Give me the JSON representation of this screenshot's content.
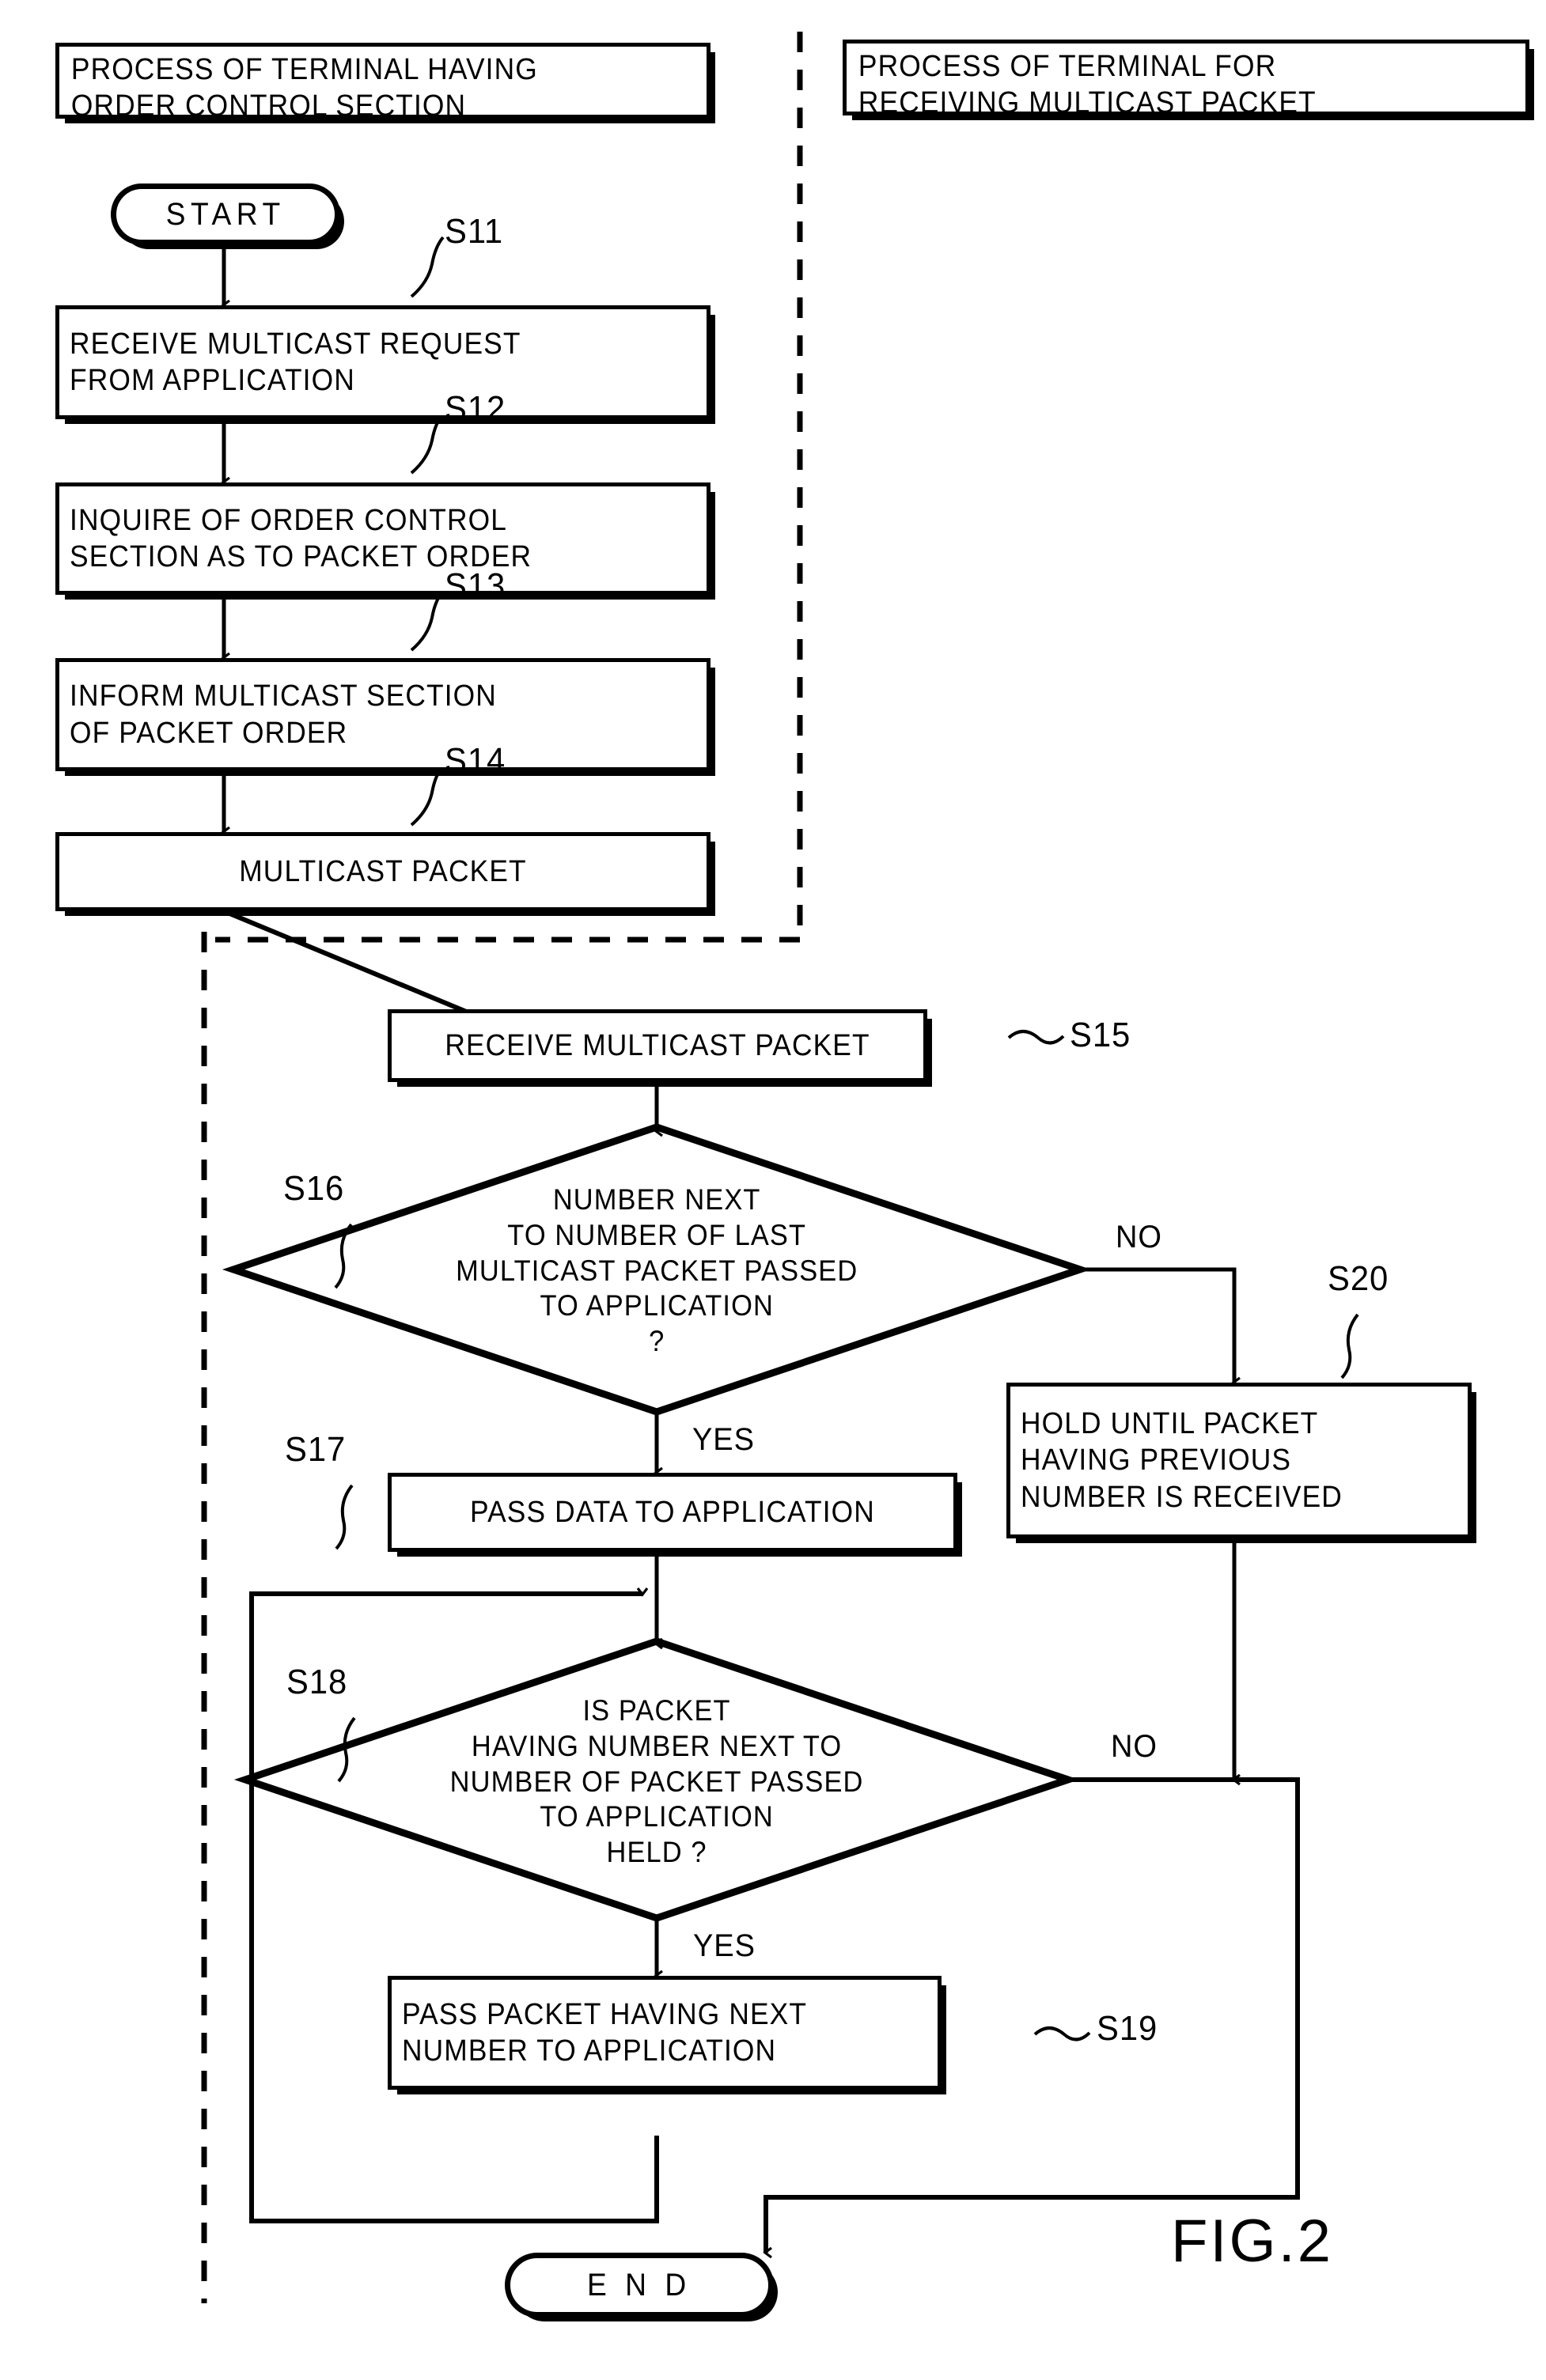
{
  "figure": {
    "label": "FIG.2",
    "lanes": [
      {
        "id": "lane-left",
        "title": "PROCESS OF TERMINAL HAVING\nORDER CONTROL SECTION"
      },
      {
        "id": "lane-right",
        "title": "PROCESS OF TERMINAL FOR\nRECEIVING MULTICAST PACKET"
      }
    ],
    "nodes": [
      {
        "id": "start",
        "type": "terminator",
        "text": "START",
        "step": ""
      },
      {
        "id": "s11",
        "type": "process",
        "text": "RECEIVE MULTICAST REQUEST\nFROM APPLICATION",
        "step": "S11"
      },
      {
        "id": "s12",
        "type": "process",
        "text": "INQUIRE OF ORDER CONTROL\nSECTION AS TO PACKET ORDER",
        "step": "S12"
      },
      {
        "id": "s13",
        "type": "process",
        "text": "INFORM MULTICAST SECTION\nOF PACKET ORDER",
        "step": "S13"
      },
      {
        "id": "s14",
        "type": "process",
        "text": "MULTICAST PACKET",
        "step": "S14"
      },
      {
        "id": "s15",
        "type": "process",
        "text": "RECEIVE MULTICAST PACKET",
        "step": "S15"
      },
      {
        "id": "s16",
        "type": "decision",
        "text": "NUMBER NEXT\nTO NUMBER OF LAST\nMULTICAST PACKET PASSED\nTO APPLICATION\n?",
        "step": "S16"
      },
      {
        "id": "s17",
        "type": "process",
        "text": "PASS DATA TO APPLICATION",
        "step": "S17"
      },
      {
        "id": "s20",
        "type": "process",
        "text": "HOLD UNTIL PACKET\nHAVING PREVIOUS\nNUMBER IS RECEIVED",
        "step": "S20"
      },
      {
        "id": "s18",
        "type": "decision",
        "text": "IS PACKET\nHAVING NUMBER NEXT TO\nNUMBER OF PACKET PASSED\nTO APPLICATION\nHELD ?",
        "step": "S18"
      },
      {
        "id": "s19",
        "type": "process",
        "text": "PASS PACKET HAVING NEXT\nNUMBER TO APPLICATION",
        "step": "S19"
      },
      {
        "id": "end",
        "type": "terminator",
        "text": "E N D",
        "step": ""
      }
    ],
    "branch_labels": {
      "s16_no": "NO",
      "s16_yes": "YES",
      "s18_no": "NO",
      "s18_yes": "YES"
    }
  }
}
